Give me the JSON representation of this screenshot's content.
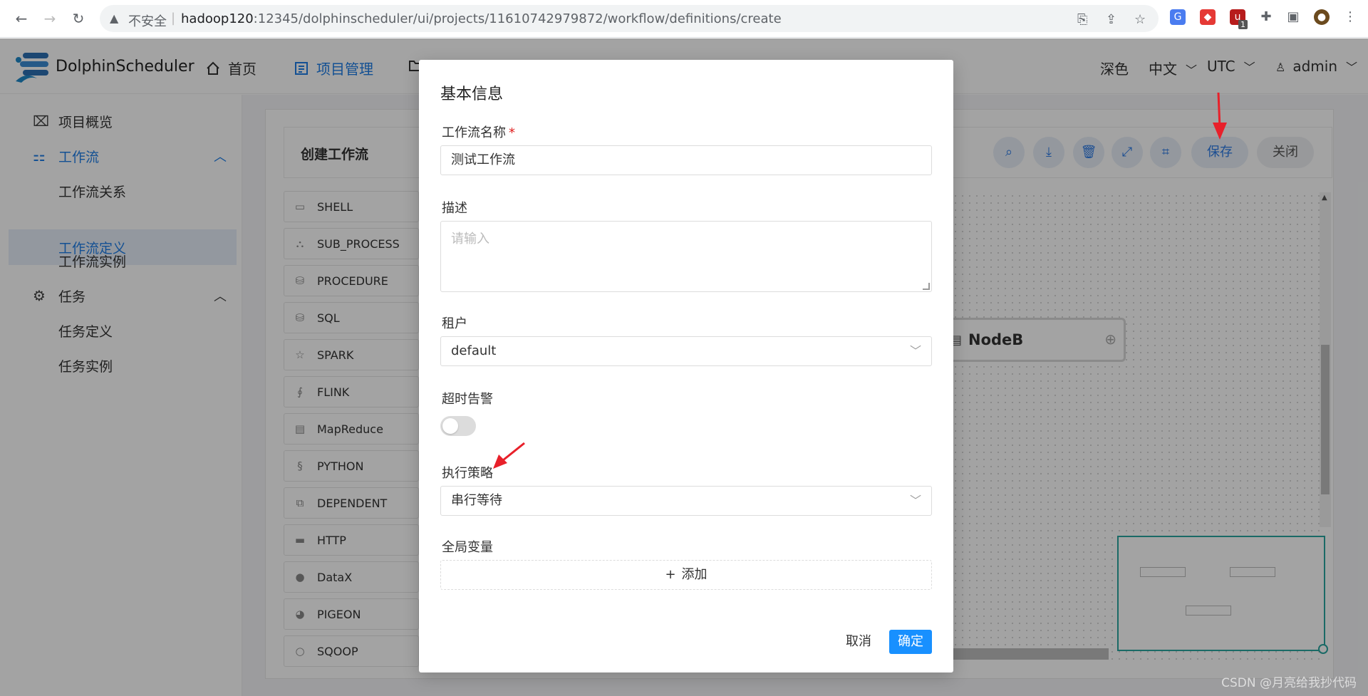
{
  "browser": {
    "insecure_label": "不安全",
    "url_host": "hadoop120",
    "url_rest": ":12345/dolphinscheduler/ui/projects/11610742979872/workflow/definitions/create",
    "ext_badge": "1"
  },
  "header": {
    "brand": "DolphinScheduler",
    "menu": [
      {
        "label": "首页",
        "icon": "home-icon"
      },
      {
        "label": "项目管理",
        "icon": "project-icon",
        "active": true
      }
    ],
    "right": {
      "theme": "深色",
      "language": "中文",
      "timezone": "UTC",
      "user": "admin"
    }
  },
  "sidebar": {
    "items": [
      {
        "label": "项目概览",
        "icon": "dashboard-icon"
      },
      {
        "label": "工作流",
        "icon": "workflow-icon",
        "active": true,
        "expanded": true
      },
      {
        "label": "工作流关系",
        "sub": true
      },
      {
        "label": "工作流定义",
        "sub": true,
        "selected": true
      },
      {
        "label": "工作流实例",
        "sub": true
      },
      {
        "label": "任务",
        "icon": "gear-icon",
        "expanded": true
      },
      {
        "label": "任务定义",
        "sub": true
      },
      {
        "label": "任务实例",
        "sub": true
      }
    ]
  },
  "canvas": {
    "panel_title": "创建工作流",
    "toolbar": {
      "save_label": "保存",
      "close_label": "关闭"
    },
    "task_types": [
      "SHELL",
      "SUB_PROCESS",
      "PROCEDURE",
      "SQL",
      "SPARK",
      "FLINK",
      "MapReduce",
      "PYTHON",
      "DEPENDENT",
      "HTTP",
      "DataX",
      "PIGEON",
      "SQOOP"
    ],
    "node_label": "NodeB"
  },
  "modal": {
    "title": "基本信息",
    "name_label": "工作流名称",
    "name_value": "测试工作流",
    "desc_label": "描述",
    "desc_placeholder": "请输入",
    "tenant_label": "租户",
    "tenant_value": "default",
    "timeout_label": "超时告警",
    "timeout_enabled": false,
    "strategy_label": "执行策略",
    "strategy_value": "串行等待",
    "globals_label": "全局变量",
    "add_label": "添加",
    "cancel_label": "取消",
    "ok_label": "确定"
  },
  "watermark": "CSDN @月亮给我抄代码",
  "colors": {
    "accent": "#1f7de6",
    "primary_button": "#1890ff",
    "minimap_border": "#2aa6a0",
    "annotation_arrow": "#e8202a"
  }
}
